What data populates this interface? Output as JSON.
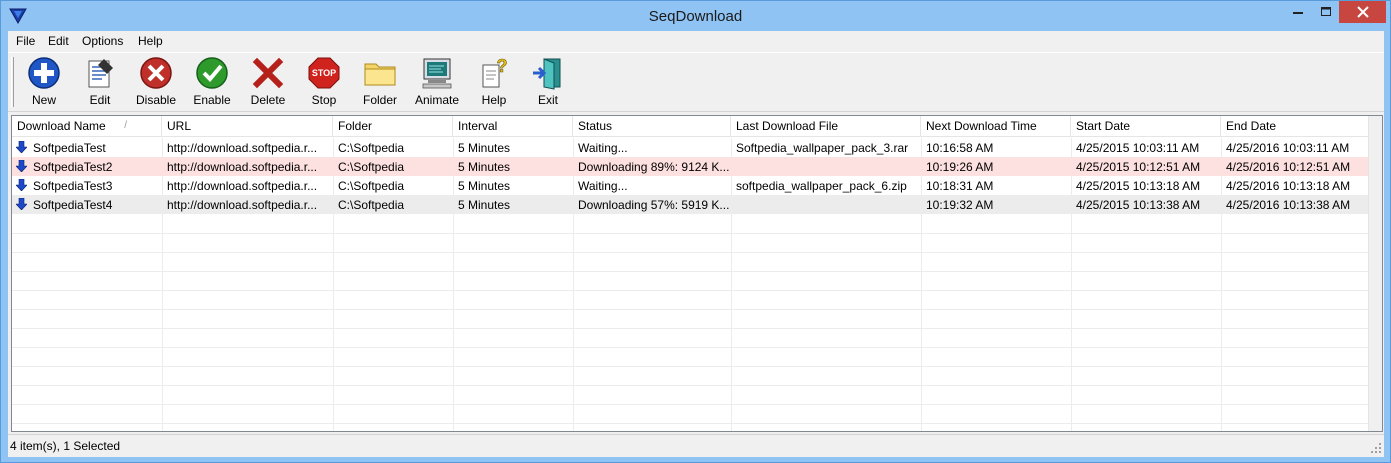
{
  "window": {
    "title": "SeqDownload",
    "app_icon": "down-triangle-icon",
    "controls": {
      "minimize_icon": "minimize-icon",
      "maximize_icon": "maximize-icon",
      "close_icon": "close-icon",
      "close_color": "#c7463f"
    }
  },
  "menu": [
    "File",
    "Edit",
    "Options",
    "Help"
  ],
  "toolbar": [
    {
      "label": "New",
      "icon": "plus-circle-icon"
    },
    {
      "label": "Edit",
      "icon": "edit-document-icon"
    },
    {
      "label": "Disable",
      "icon": "disable-x-circle-icon"
    },
    {
      "label": "Enable",
      "icon": "check-circle-icon"
    },
    {
      "label": "Delete",
      "icon": "red-x-icon"
    },
    {
      "label": "Stop",
      "icon": "stop-sign-icon"
    },
    {
      "label": "Folder",
      "icon": "folder-icon"
    },
    {
      "label": "Animate",
      "icon": "computer-monitor-icon"
    },
    {
      "label": "Help",
      "icon": "question-doc-icon"
    },
    {
      "label": "Exit",
      "icon": "exit-door-icon"
    }
  ],
  "list": {
    "columns": [
      "Download Name",
      "URL",
      "Folder",
      "Interval",
      "Status",
      "Last Download File",
      "Next Download Time",
      "Start Date",
      "End Date"
    ],
    "sort_indicator": "/",
    "rows": [
      [
        "SoftpediaTest",
        "http://download.softpedia.r...",
        "C:\\Softpedia",
        "5 Minutes",
        "Waiting...",
        "Softpedia_wallpaper_pack_3.rar",
        "10:16:58 AM",
        "4/25/2015 10:03:11 AM",
        "4/25/2016 10:03:11 AM"
      ],
      [
        "SoftpediaTest2",
        "http://download.softpedia.r...",
        "C:\\Softpedia",
        "5 Minutes",
        "Downloading 89%: 9124 K...",
        "",
        "10:19:26 AM",
        "4/25/2015 10:12:51 AM",
        "4/25/2016 10:12:51 AM"
      ],
      [
        "SoftpediaTest3",
        "http://download.softpedia.r...",
        "C:\\Softpedia",
        "5 Minutes",
        "Waiting...",
        "softpedia_wallpaper_pack_6.zip",
        "10:18:31 AM",
        "4/25/2015 10:13:18 AM",
        "4/25/2016 10:13:18 AM"
      ],
      [
        "SoftpediaTest4",
        "http://download.softpedia.r...",
        "C:\\Softpedia",
        "5 Minutes",
        "Downloading 57%: 5919 K...",
        "",
        "10:19:32 AM",
        "4/25/2015 10:13:38 AM",
        "4/25/2016 10:13:38 AM"
      ]
    ],
    "row_icon": "download-arrow-icon",
    "selected_row_color": "#fde0e0"
  },
  "status": {
    "text": "4 item(s), 1 Selected"
  }
}
